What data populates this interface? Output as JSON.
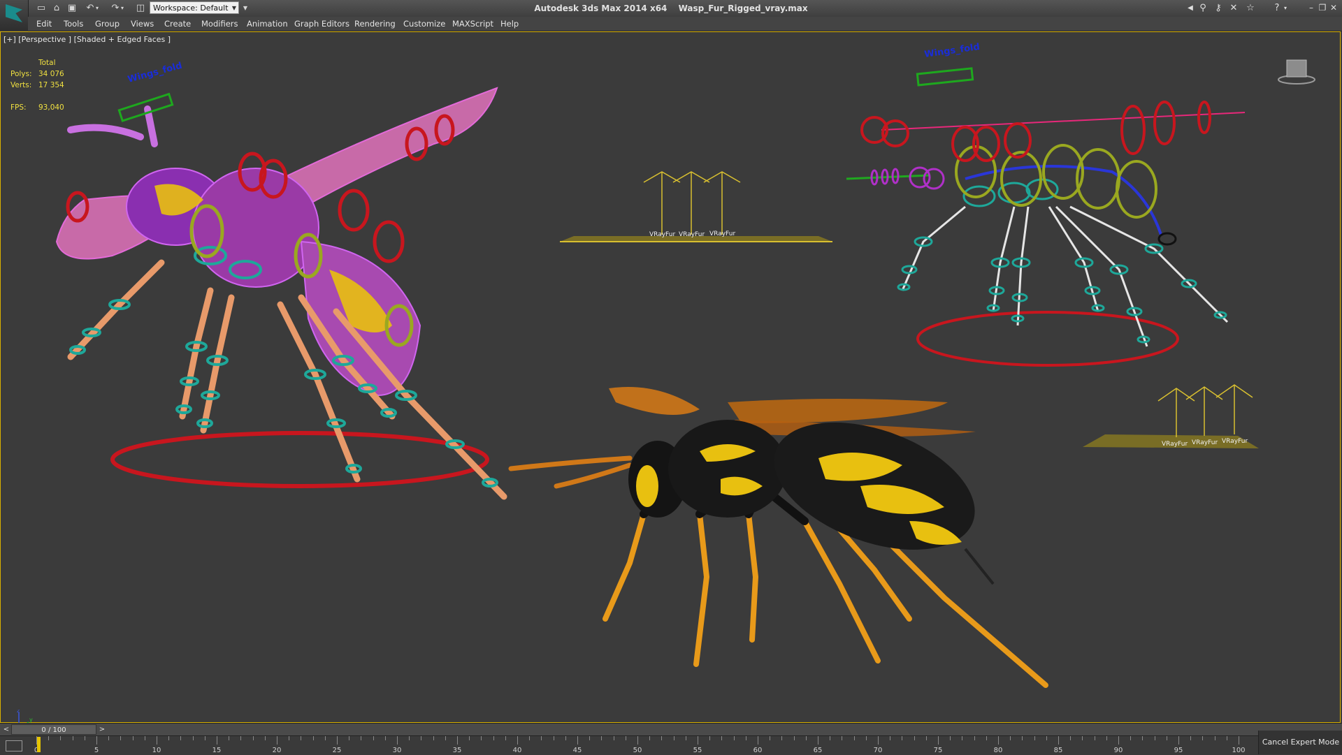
{
  "app": {
    "name": "Autodesk 3ds Max  2014 x64",
    "file": "Wasp_Fur_Rigged_vray.max",
    "workspace": "Workspace: Default"
  },
  "menu": [
    "Edit",
    "Tools",
    "Group",
    "Views",
    "Create",
    "Modifiers",
    "Animation",
    "Graph Editors",
    "Rendering",
    "Customize",
    "MAXScript",
    "Help"
  ],
  "viewport": {
    "label": "[+] [Perspective ] [Shaded + Edged Faces ]",
    "stats": {
      "header": "Total",
      "polys_label": "Polys:",
      "polys": "34 076",
      "verts_label": "Verts:",
      "verts": "17 354",
      "fps_label": "FPS:",
      "fps": "93,040"
    },
    "annotations": {
      "wings_fold": "Wings_fold",
      "vrayfur": "VRayFur"
    },
    "gizmo_axes": {
      "z": "z",
      "x": "x",
      "y": "y"
    }
  },
  "timeline": {
    "frame_display": "0 / 100",
    "prev": "<",
    "next": ">",
    "ticks": [
      "0",
      "5",
      "10",
      "15",
      "20",
      "25",
      "30",
      "35",
      "40",
      "45",
      "50",
      "55",
      "60",
      "65",
      "70",
      "75",
      "80",
      "85",
      "90",
      "95",
      "100"
    ]
  },
  "status": {
    "cancel_expert": "Cancel Expert Mode"
  },
  "colors": {
    "accent_yellow": "#e5c400",
    "viewport_bg": "#3b3b3b",
    "control_red": "#c8161e",
    "control_cyan": "#1ea89a",
    "control_green": "#9aa820",
    "wire_magenta": "#c857e0"
  }
}
